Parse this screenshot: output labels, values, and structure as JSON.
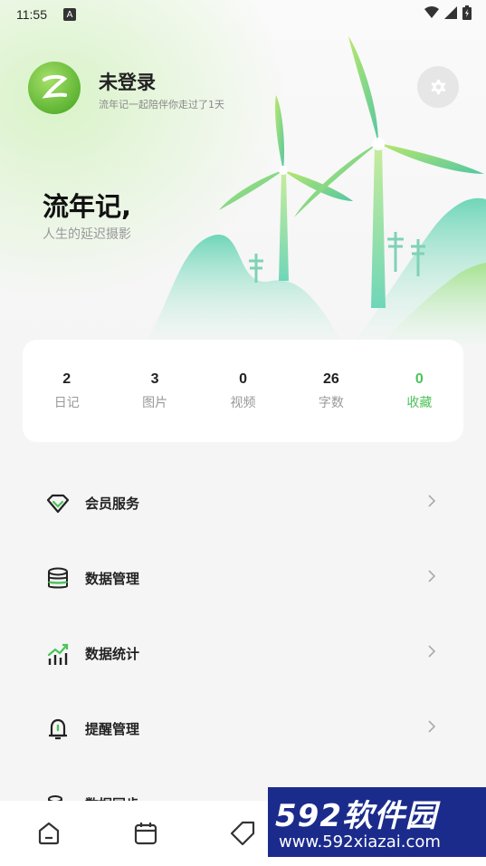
{
  "status_bar": {
    "time": "11:55",
    "badge": "A"
  },
  "profile": {
    "name": "未登录",
    "subtitle": "流年记一起陪伴你走过了1天"
  },
  "slogan": {
    "title": "流年记,",
    "subtitle": "人生的延迟摄影"
  },
  "stats": [
    {
      "value": "2",
      "label": "日记"
    },
    {
      "value": "3",
      "label": "图片"
    },
    {
      "value": "0",
      "label": "视频"
    },
    {
      "value": "26",
      "label": "字数"
    },
    {
      "value": "0",
      "label": "收藏"
    }
  ],
  "menu": [
    {
      "label": "会员服务",
      "icon": "diamond-icon"
    },
    {
      "label": "数据管理",
      "icon": "database-icon"
    },
    {
      "label": "数据统计",
      "icon": "chart-icon"
    },
    {
      "label": "提醒管理",
      "icon": "bell-icon"
    },
    {
      "label": "数据同步",
      "icon": "sync-icon"
    }
  ],
  "bottom_nav": [
    {
      "icon": "home-icon"
    },
    {
      "icon": "calendar-icon"
    },
    {
      "icon": "tag-icon"
    }
  ],
  "watermark": {
    "brand": "592软件园",
    "url": "www.592xiazai.com"
  },
  "colors": {
    "accent": "#4cc35a",
    "background": "#f5f5f5"
  }
}
